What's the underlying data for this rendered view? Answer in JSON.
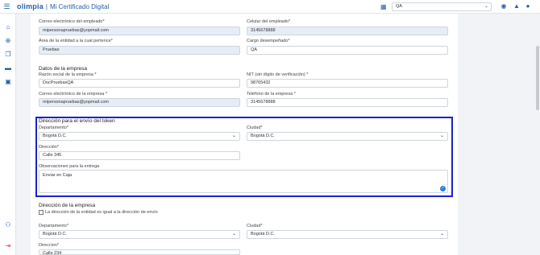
{
  "header": {
    "logo": "olimpia",
    "separator": "|",
    "app_title": "Mi Certificado Digital",
    "company_select": "QA"
  },
  "form": {
    "employee_email_label": "Correo electrónico del empleado*",
    "employee_email_value": "mipersonapruebas@yopmail.com",
    "employee_phone_label": "Celular del empleado*",
    "employee_phone_value": "3145678888",
    "area_label": "Área de la entidad a la cual pertence*",
    "area_value": "Pruebas",
    "position_label": "Cargo desempeñado*",
    "position_value": "QA",
    "company_section_title": "Datos de la empresa",
    "company_name_label": "Razón social de la empresa *",
    "company_name_value": "DocPruebasQA",
    "nit_label": "NIT (sin dígito de verificación) *",
    "nit_value": "98765432",
    "company_email_label": "Correo electrónico de la empresa *",
    "company_email_value": "mipersonapruebas@yopmail.com",
    "company_phone_label": "Teléfono de la empresa *",
    "company_phone_value": "3145678888",
    "token_section_title": "Dirección para el envío del token",
    "token_department_label": "Departamento*",
    "token_department_value": "Bogotá D.C.",
    "token_city_label": "Ciudad*",
    "token_city_value": "Bogotá D.C.",
    "token_address_label": "Dirección*",
    "token_address_value": "Calle 345",
    "token_notes_label": "Observaciones para la entrega",
    "token_notes_value": "Enviar en Caja",
    "company_address_title": "Dirección de la empresa",
    "same_address_label": "La dirección de la entidad es igual a la dirección de envío",
    "company_department_label": "Departamento*",
    "company_department_value": "Bogotá D.C.",
    "company_city_label": "Ciudad*",
    "company_city_value": "Bogotá D.C.",
    "company_address_label": "Direccion*",
    "company_address_value": "Calle 234"
  }
}
